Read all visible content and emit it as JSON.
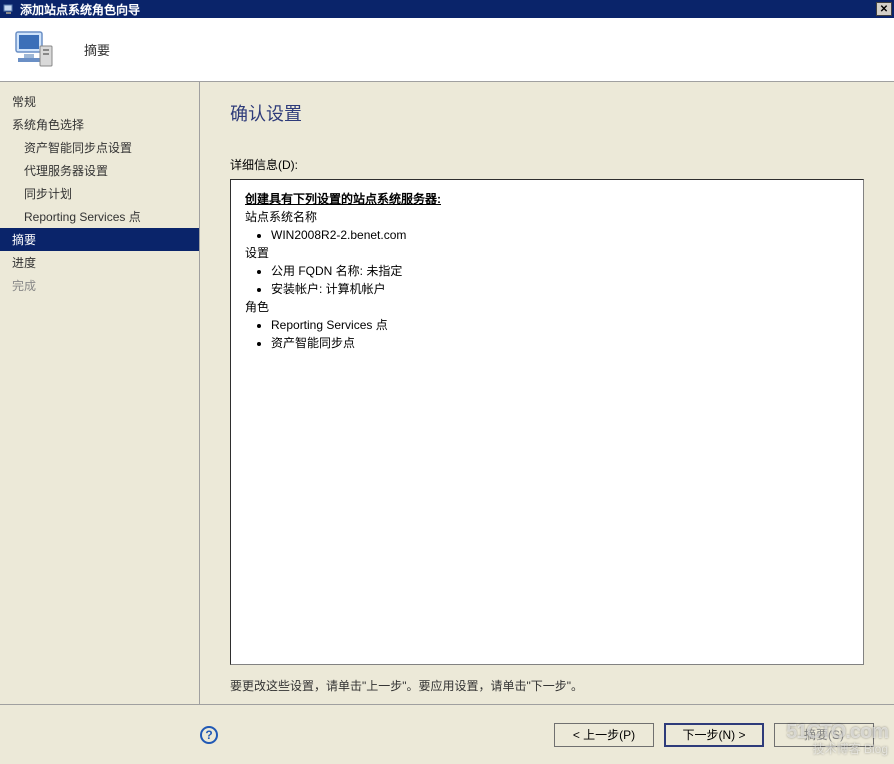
{
  "window": {
    "title": "添加站点系统角色向导",
    "close_label": "✕"
  },
  "header": {
    "title": "摘要"
  },
  "sidebar": {
    "items": [
      {
        "label": "常规",
        "indent": false,
        "selected": false,
        "disabled": false
      },
      {
        "label": "系统角色选择",
        "indent": false,
        "selected": false,
        "disabled": false
      },
      {
        "label": "资产智能同步点设置",
        "indent": true,
        "selected": false,
        "disabled": false
      },
      {
        "label": "代理服务器设置",
        "indent": true,
        "selected": false,
        "disabled": false
      },
      {
        "label": "同步计划",
        "indent": true,
        "selected": false,
        "disabled": false
      },
      {
        "label": "Reporting Services 点",
        "indent": true,
        "selected": false,
        "disabled": false
      },
      {
        "label": "摘要",
        "indent": false,
        "selected": true,
        "disabled": false
      },
      {
        "label": "进度",
        "indent": false,
        "selected": false,
        "disabled": false
      },
      {
        "label": "完成",
        "indent": false,
        "selected": false,
        "disabled": true
      }
    ]
  },
  "main": {
    "heading": "确认设置",
    "details_label": "详细信息(D):",
    "details": {
      "heading": "创建具有下列设置的站点系统服务器:",
      "site_name_label": "站点系统名称",
      "site_name_value": "WIN2008R2-2.benet.com",
      "settings_label": "设置",
      "settings_items": [
        "公用 FQDN 名称: 未指定",
        "安装帐户: 计算机帐户"
      ],
      "roles_label": "角色",
      "roles_items": [
        "Reporting Services 点",
        "资产智能同步点"
      ]
    },
    "instruction": "要更改这些设置，请单击\"上一步\"。要应用设置，请单击\"下一步\"。"
  },
  "footer": {
    "help_tooltip": "帮助",
    "prev_label": "< 上一步(P)",
    "next_label": "下一步(N) >",
    "summary_label": "摘要(S)"
  },
  "watermark": {
    "line1": "51CTO.com",
    "line2": "技术博客  Blog"
  }
}
